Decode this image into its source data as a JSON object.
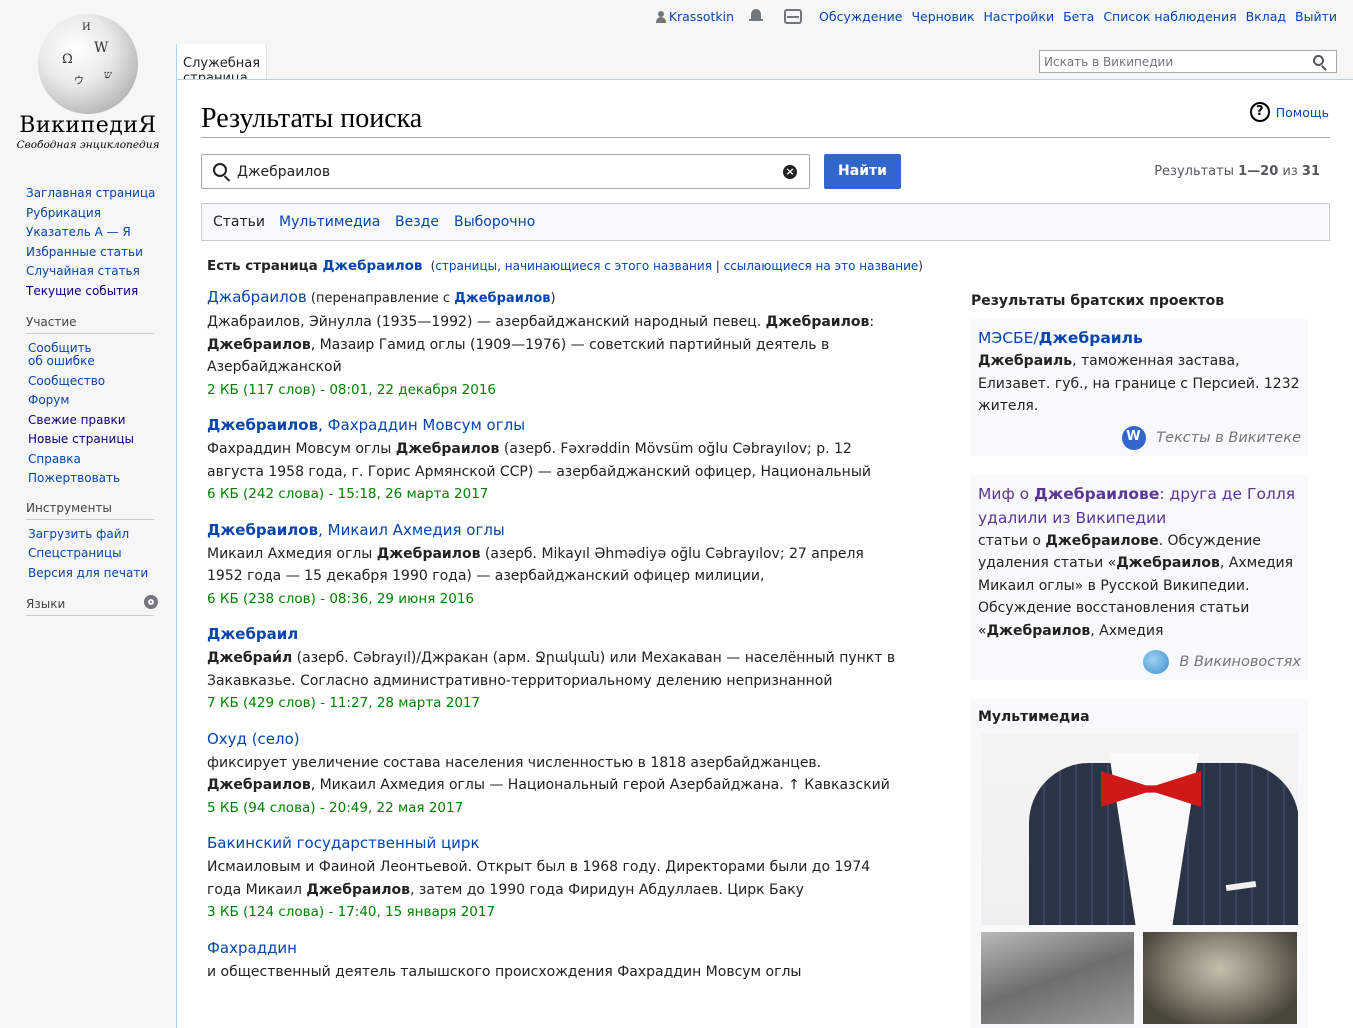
{
  "personal": {
    "username": "Krassotkin",
    "links": [
      "Обсуждение",
      "Черновик",
      "Настройки",
      "Бета",
      "Список наблюдения",
      "Вклад",
      "Выйти"
    ]
  },
  "logo": {
    "wordmark": "ВикипедиЯ",
    "tagline": "Свободная энциклопедия"
  },
  "sidebar": {
    "nav": [
      "Заглавная страница",
      "Рубрикация",
      "Указатель А — Я",
      "Избранные статьи",
      "Случайная статья",
      "Текущие события"
    ],
    "participation": {
      "heading": "Участие",
      "items": [
        "Сообщить\nоб ошибке",
        "Сообщество",
        "Форум",
        "Свежие правки",
        "Новые страницы",
        "Справка",
        "Пожертвовать"
      ]
    },
    "tools": {
      "heading": "Инструменты",
      "items": [
        "Загрузить файл",
        "Спецстраницы",
        "Версия для печати"
      ]
    },
    "languages": {
      "heading": "Языки"
    }
  },
  "tab": {
    "label": "Служебная страница"
  },
  "search": {
    "placeholder": "Искать в Википедии"
  },
  "page": {
    "title": "Результаты поиска",
    "help": "Помощь",
    "query": "Джебраилов",
    "find_button": "Найти",
    "results_prefix": "Результаты ",
    "results_range": "1—20",
    "results_of": " из ",
    "results_total": "31",
    "profiles": [
      "Статьи",
      "Мультимедиа",
      "Везде",
      "Выборочно"
    ],
    "exists": {
      "prefix": "Есть страница ",
      "title": "Джебраилов",
      "links": [
        "страницы, начинающиеся с этого названия",
        "ссылающиеся на это название"
      ]
    }
  },
  "results": [
    {
      "title_pre": "Джабраилов",
      "title_bold": "",
      "title_post": "",
      "redir_text": "(перенаправление с ",
      "redir_target": "Джебраилов",
      "snippet": [
        {
          "t": "Джабраилов, Эйнулла (1935—1992) — азербайджанский народный певец. "
        },
        {
          "b": "Джебраилов"
        },
        {
          "t": ": "
        },
        {
          "b": "Джебраилов"
        },
        {
          "t": ", Мазаир Гамид оглы (1909—1976) — советский партийный деятель в Азербайджанской"
        }
      ],
      "meta": "2 КБ (117 слов) - 08:01, 22 декабря 2016"
    },
    {
      "title_pre": "",
      "title_bold": "Джебраилов",
      "title_post": ", Фахраддин Мовсум оглы",
      "snippet": [
        {
          "t": "Фахраддин Мовсум оглы "
        },
        {
          "b": "Джебраилов"
        },
        {
          "t": " (азерб. Fəxrəddin Mövsüm oğlu Cəbrayılov; р. 12 августа 1958 года, г. Горис Армянской ССР) — азербайджанский офицер, Национальный"
        }
      ],
      "meta": "6 КБ (242 слова) - 15:18, 26 марта 2017"
    },
    {
      "title_pre": "",
      "title_bold": "Джебраилов",
      "title_post": ", Микаил Ахмедия оглы",
      "snippet": [
        {
          "t": "Микаил Ахмедия оглы "
        },
        {
          "b": "Джебраилов"
        },
        {
          "t": " (азерб. Mikayıl Əhmədiyə oğlu Cəbrayılov; 27 апреля 1952 года — 15 декабря 1990 года) — азербайджанский офицер милиции,"
        }
      ],
      "meta": "6 КБ (238 слов) - 08:36, 29 июня 2016"
    },
    {
      "title_pre": "",
      "title_bold": "Джебраил",
      "title_post": "",
      "snippet": [
        {
          "b": "Джебраи́л"
        },
        {
          "t": " (азерб. Cəbrayıl)/Джракан (арм. Ջրական) или Мехакаван — населённый пункт в Закавказье. Согласно административно-территориальному делению непризнанной"
        }
      ],
      "meta": "7 КБ (429 слов) - 11:27, 28 марта 2017"
    },
    {
      "title_pre": "Охуд (село)",
      "title_bold": "",
      "title_post": "",
      "snippet": [
        {
          "t": "фиксирует увеличение состава населения численностью в 1818 азербайджанцев. "
        },
        {
          "b": "Джебраилов"
        },
        {
          "t": ", Микаил Ахмедия оглы — Национальный герой Азербайджана. ↑ Кавказский"
        }
      ],
      "meta": "5 КБ (94 слова) - 20:49, 22 мая 2017"
    },
    {
      "title_pre": "Бакинский государственный цирк",
      "title_bold": "",
      "title_post": "",
      "snippet": [
        {
          "t": "Исмаиловым и Фаиной Леонтьевой. Открыт был в 1968 году. Директорами были до 1974 года Микаил "
        },
        {
          "b": "Джебраилов"
        },
        {
          "t": ", затем до 1990 года Фиридун Абдуллаев. Цирк Баку"
        }
      ],
      "meta": "3 КБ (124 слова) - 17:40, 15 января 2017"
    },
    {
      "title_pre": "Фахраддин",
      "title_bold": "",
      "title_post": "",
      "snippet": [
        {
          "t": "и общественный деятель талышского происхождения Фахраддин Мовсум оглы"
        }
      ],
      "meta": ""
    }
  ],
  "sister": {
    "heading": "Результаты братских проектов",
    "wikisource": {
      "title_pre": "МЭСБЕ/",
      "title_bold": "Джебраиль",
      "snippet": [
        {
          "b": "Джебраиль"
        },
        {
          "t": ", таможенная застава, Елизавет. губ., на границе с Персией. 1232 жителя."
        }
      ],
      "footer": "Тексты в Викитеке"
    },
    "wikinews": {
      "title_pre": "Миф о ",
      "title_bold": "Джебраилове",
      "title_post": ": друга де Голля удалили из Википедии",
      "snippet": [
        {
          "t": "статьи о "
        },
        {
          "b": "Джебраилове"
        },
        {
          "t": ". Обсуждение удаления статьи «"
        },
        {
          "b": "Джебраилов"
        },
        {
          "t": ", Ахмедия Микаил оглы» в Русской Википедии. Обсуждение восстановления статьи «"
        },
        {
          "b": "Джебраилов"
        },
        {
          "t": ", Ахмедия"
        }
      ],
      "footer": "В Викиновостях"
    },
    "multimedia": {
      "heading": "Мультимедиа"
    }
  },
  "colors": {
    "link": "#0645ad",
    "visited": "#0b0080",
    "meta": "#008000",
    "button": "#3366cc",
    "wikinews_title": "#5a3696"
  }
}
